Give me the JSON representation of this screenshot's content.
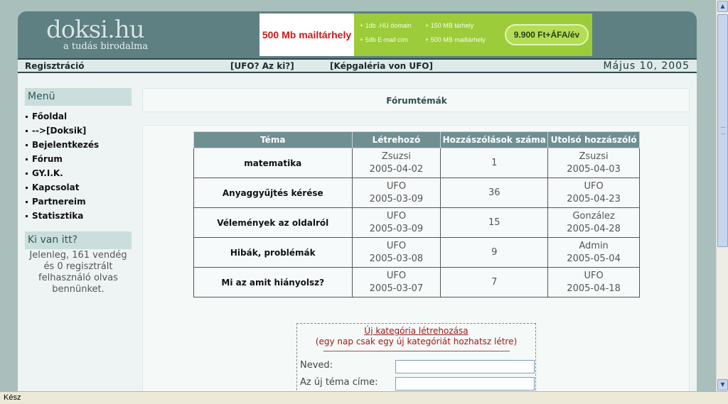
{
  "header": {
    "logo_main": "doksi.hu",
    "logo_sub": "a tudás birodalma",
    "banner": {
      "headline": "500 Mb mailtárhely",
      "features": [
        "+ 1db .HU domain",
        "+ 150 MB tárhely",
        "+ 5db E-mail cím",
        "+ 500 MB mailtárhely"
      ],
      "price": "9.900 Ft+ÁFA/év"
    }
  },
  "navbar": {
    "register": "Regisztráció",
    "link1": "[UFO? Az ki?]",
    "link2": "[Képgaléria von UFO]",
    "date": "Május 10, 2005"
  },
  "sidebar": {
    "menu_title": "Menü",
    "items": [
      {
        "label": "Főoldal"
      },
      {
        "label": "-->[Doksik]"
      },
      {
        "label": "Bejelentkezés"
      },
      {
        "label": "Fórum"
      },
      {
        "label": "GY.I.K."
      },
      {
        "label": "Kapcsolat"
      },
      {
        "label": "Partnereim"
      },
      {
        "label": "Statisztika"
      }
    ],
    "who_title": "Ki van itt?",
    "who_text": "Jelenleg, 161 vendég és 0 regisztrált felhasználó olvas bennünket."
  },
  "forum": {
    "title": "Fórumtémák",
    "columns": [
      "Téma",
      "Létrehozó",
      "Hozzászólások száma",
      "Utolsó hozzászóló"
    ],
    "rows": [
      {
        "topic": "matematika",
        "creator": "Zsuzsi",
        "created": "2005-04-02",
        "count": "1",
        "last_user": "Zsuzsi",
        "last_date": "2005-04-03"
      },
      {
        "topic": "Anyaggyűjtés kérése",
        "creator": "UFO",
        "created": "2005-03-09",
        "count": "36",
        "last_user": "UFO",
        "last_date": "2005-04-23"
      },
      {
        "topic": "Vélemények az oldalról",
        "creator": "UFO",
        "created": "2005-03-09",
        "count": "15",
        "last_user": "González",
        "last_date": "2005-04-28"
      },
      {
        "topic": "Hibák, problémák",
        "creator": "UFO",
        "created": "2005-03-08",
        "count": "9",
        "last_user": "Admin",
        "last_date": "2005-05-04"
      },
      {
        "topic": "Mi az amit hiányolsz?",
        "creator": "UFO",
        "created": "2005-03-07",
        "count": "7",
        "last_user": "UFO",
        "last_date": "2005-04-18"
      }
    ],
    "new_category": {
      "link": "Új kategória létrehozása",
      "note": "(egy nap csak egy új kategóriát hozhatsz létre)",
      "name_label": "Neved:",
      "name_value": "",
      "topic_label": "Az új téma címe:",
      "topic_value": ""
    }
  },
  "status": "Kész"
}
